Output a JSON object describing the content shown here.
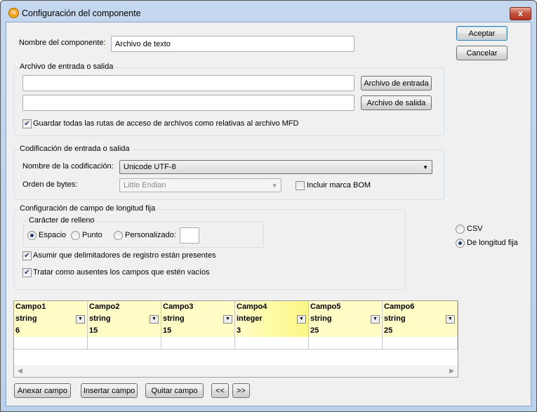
{
  "window": {
    "title": "Configuración del componente",
    "icon": "altova-mapforce-icon",
    "close": "x"
  },
  "buttons": {
    "ok": "Aceptar",
    "cancel": "Cancelar"
  },
  "component_name": {
    "label": "Nombre del componente:",
    "value": "Archivo de texto"
  },
  "file_group": {
    "title": "Archivo de entrada o salida",
    "input_value": "",
    "output_value": "",
    "input_button": "Archivo de entrada",
    "output_button": "Archivo de salida",
    "relative_checkbox": {
      "label": "Guardar todas las rutas de acceso de archivos como relativas al archivo MFD",
      "checked": true
    }
  },
  "encoding_group": {
    "title": "Codificación de entrada o salida",
    "encoding_label": "Nombre de la codificación:",
    "encoding_value": "Unicode UTF-8",
    "byte_order_label": "Orden de bytes:",
    "byte_order_value": "Little Endian",
    "bom_checkbox": {
      "label": "Incluir marca BOM",
      "checked": false
    }
  },
  "fixed_group": {
    "title": "Configuración de campo de longitud fija",
    "fill_group": {
      "title": "Carácter de relleno",
      "options": [
        {
          "label": "Espacio",
          "checked": true
        },
        {
          "label": "Punto",
          "checked": false
        },
        {
          "label": "Personalizado:",
          "checked": false
        }
      ],
      "custom_value": ""
    },
    "delimiters_checkbox": {
      "label": "Asumir que delimitadores de registro están presentes",
      "checked": true
    },
    "empty_checkbox": {
      "label": "Tratar como ausentes los campos que estén vacíos",
      "checked": true
    }
  },
  "format": {
    "options": [
      {
        "label": "CSV",
        "checked": false
      },
      {
        "label": "De longitud fija",
        "checked": true
      }
    ]
  },
  "grid": {
    "columns": [
      {
        "name": "Campo1",
        "type": "string",
        "length": "6"
      },
      {
        "name": "Campo2",
        "type": "string",
        "length": "15"
      },
      {
        "name": "Campo3",
        "type": "string",
        "length": "15"
      },
      {
        "name": "Campo4",
        "type": "integer",
        "length": "3"
      },
      {
        "name": "Campo5",
        "type": "string",
        "length": "25"
      },
      {
        "name": "Campo6",
        "type": "string",
        "length": "25"
      }
    ],
    "selected_column": 3,
    "highlight_color": "#fbf785",
    "row_color": "#fffcc6"
  },
  "bottom_buttons": {
    "append": "Anexar campo",
    "insert": "Insertar campo",
    "remove": "Quitar campo",
    "prev": "<<",
    "next": ">>"
  }
}
